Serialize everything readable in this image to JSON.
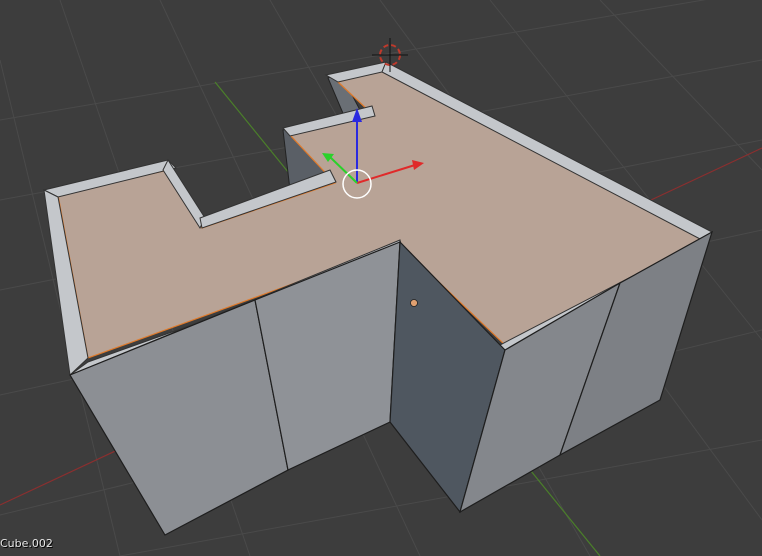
{
  "viewport": {
    "object_name": "Cube.002"
  },
  "colors": {
    "background": "#3d3d3d",
    "grid": "#4a4a4a",
    "axis_x": "#8b2f2f",
    "axis_y": "#4b7f2a",
    "wall_face_light": "#8a8d91",
    "wall_face_dark": "#505860",
    "wall_top": "#bfc2c6",
    "floor_selected": "#b8a396",
    "selection_outline": "#e07a2a",
    "gizmo_x": "#e02a2a",
    "gizmo_y": "#2ad12a",
    "gizmo_z": "#2a2ae0",
    "cursor_red": "#c0392b"
  },
  "gizmo": {
    "icon": "transform-gizmo-icon"
  },
  "cursor": {
    "icon": "3d-cursor-icon"
  }
}
